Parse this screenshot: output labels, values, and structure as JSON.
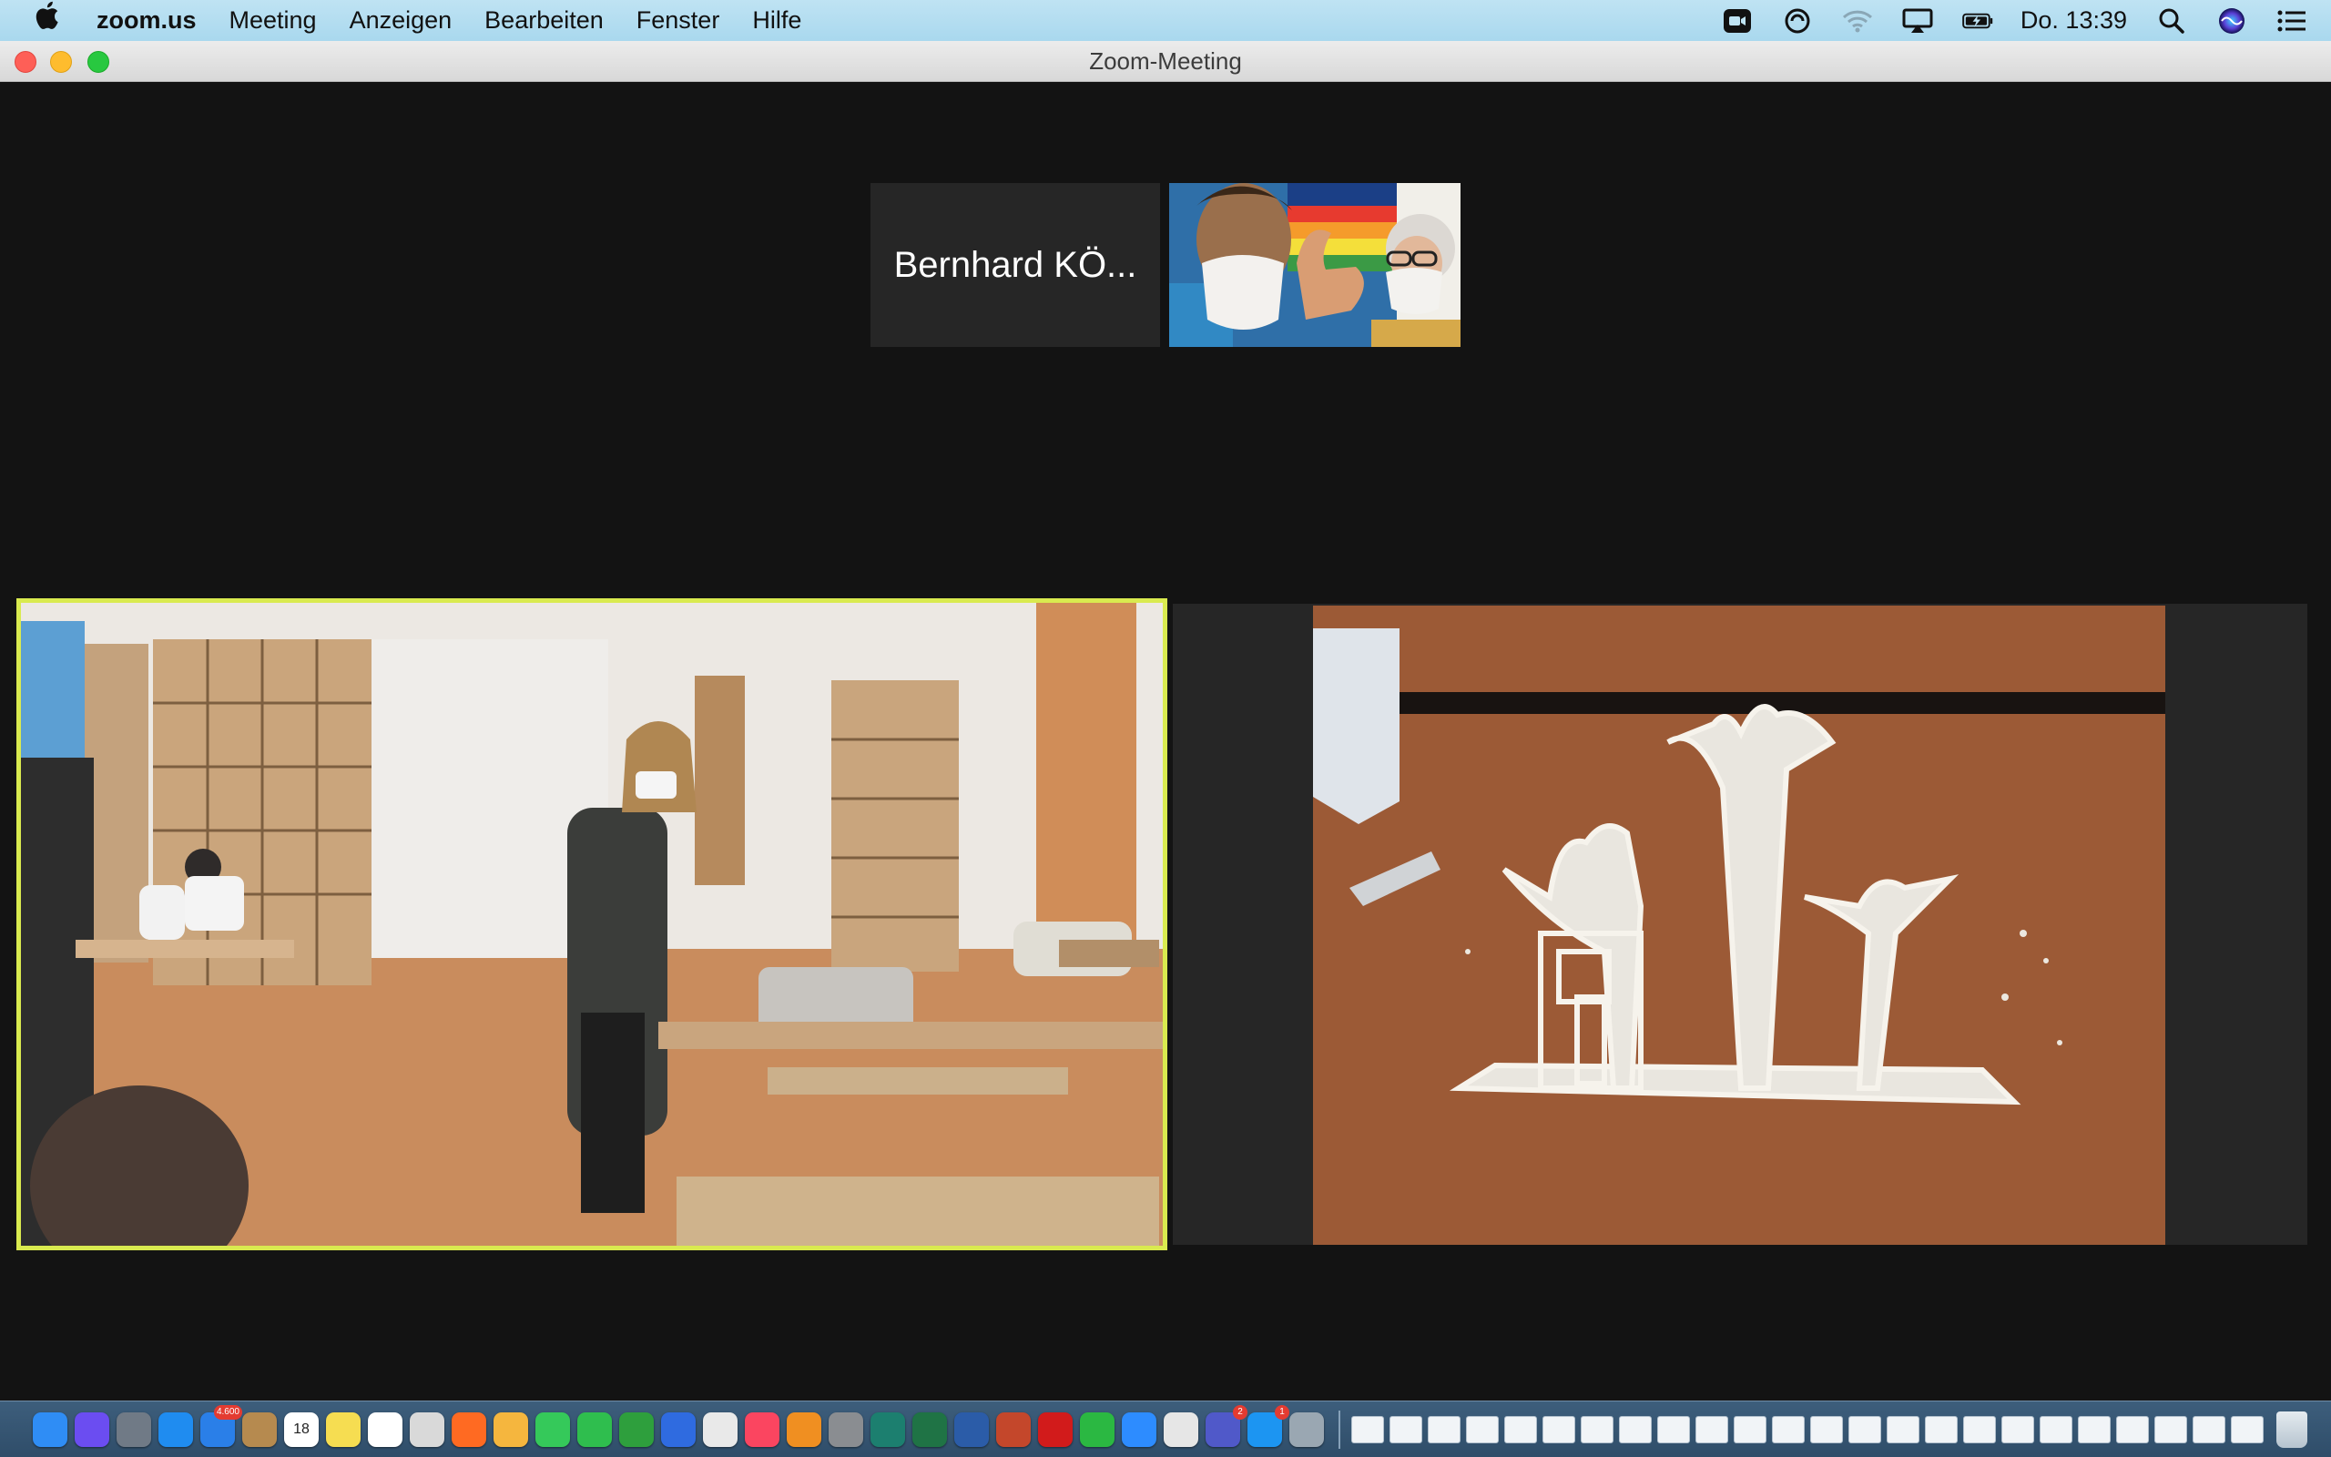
{
  "menubar": {
    "apple_icon": "apple-logo",
    "app_name": "zoom.us",
    "items": [
      "Meeting",
      "Anzeigen",
      "Bearbeiten",
      "Fenster",
      "Hilfe"
    ],
    "clock": "Do. 13:39",
    "status_icons": [
      "zoom-icon",
      "sync-icon",
      "wifi-icon",
      "airplay-icon",
      "battery-icon",
      "search-icon",
      "siri-icon",
      "control-center-icon"
    ]
  },
  "window": {
    "title": "Zoom-Meeting"
  },
  "participants": {
    "name_tile": "Bernhard KÖ..."
  },
  "dock": {
    "badges": {
      "mail": "4.600",
      "calendar_day": "18",
      "teams": "2",
      "appstore": "1"
    },
    "apps": [
      "finder",
      "siri",
      "launchpad",
      "safari",
      "mail",
      "notes-book",
      "calendar",
      "stickies",
      "reminders",
      "preview",
      "firefox",
      "photos",
      "messages",
      "facetime",
      "numbers",
      "keynote",
      "chrome",
      "music",
      "books",
      "system-preferences",
      "messenger",
      "excel",
      "word",
      "powerpoint",
      "acrobat",
      "whatsapp",
      "zoom",
      "airmail",
      "teams",
      "app-store",
      "image-capture"
    ],
    "colors": {
      "finder": "#2f8df5",
      "siri": "#6b4df1",
      "launchpad": "#707a86",
      "safari": "#1f8cf0",
      "mail": "#2a7fe8",
      "notes-book": "#b68a4f",
      "calendar": "#ffffff",
      "stickies": "#f6dd51",
      "reminders": "#ffffff",
      "preview": "#d9d9d9",
      "firefox": "#ff6a22",
      "photos": "#f5b63e",
      "messages": "#35c95a",
      "facetime": "#2fbe4e",
      "numbers": "#2e9f3d",
      "keynote": "#2f6be0",
      "chrome": "#e9e9e9",
      "music": "#fb4560",
      "books": "#f08f21",
      "system-preferences": "#8a8d91",
      "messenger": "#1c7f6f",
      "excel": "#1f7345",
      "word": "#2b5ca8",
      "powerpoint": "#c4472b",
      "acrobat": "#d21b1b",
      "whatsapp": "#2bb842",
      "zoom": "#2d8cff",
      "airmail": "#e6e6e6",
      "teams": "#5059c9",
      "app-store": "#1c95f2",
      "image-capture": "#9aa7b2"
    },
    "document_count": 24
  }
}
